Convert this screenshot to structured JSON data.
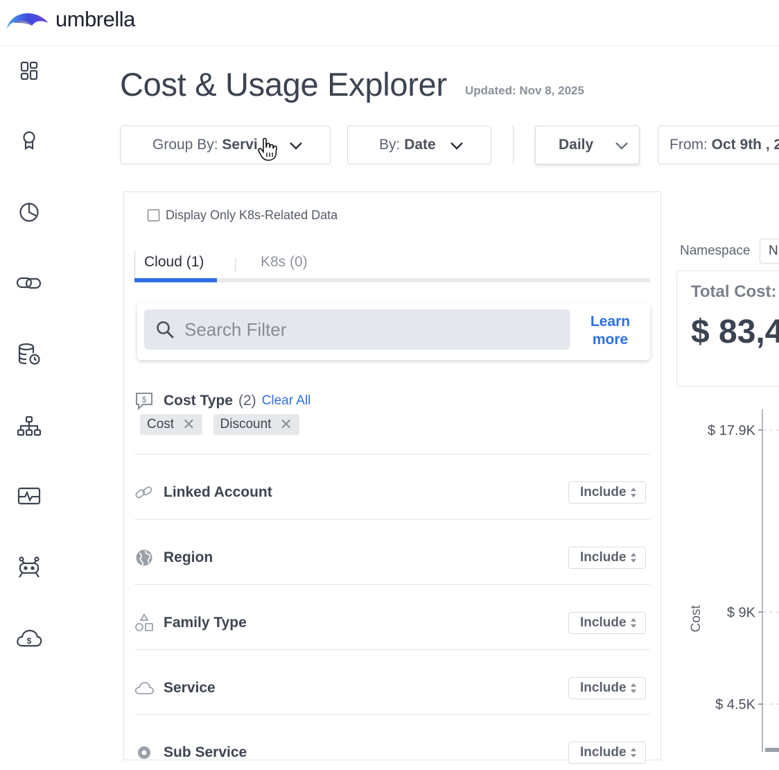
{
  "app": {
    "brand": "umbrella"
  },
  "leftnav": {
    "items": [
      {
        "name": "dashboard-icon"
      },
      {
        "name": "award-icon"
      },
      {
        "name": "pie-chart-icon"
      },
      {
        "name": "link-icon"
      },
      {
        "name": "database-clock-icon"
      },
      {
        "name": "hierarchy-icon"
      },
      {
        "name": "monitor-pulse-icon"
      },
      {
        "name": "bot-icon"
      },
      {
        "name": "cloud-dollar-icon"
      }
    ]
  },
  "header": {
    "title": "Cost & Usage Explorer",
    "updated": "Updated: Nov 8, 2025"
  },
  "controls": {
    "group_by_prefix": "Group By: ",
    "group_by_value": "Servi",
    "by_prefix": "By: ",
    "by_value": "Date",
    "granularity": "Daily",
    "from_prefix": "From: ",
    "from_value": "Oct 9th , 2"
  },
  "filters": {
    "k8s_only_label": "Display Only K8s-Related Data",
    "tabs": {
      "cloud": "Cloud (1)",
      "k8s": "K8s (0)"
    },
    "search_placeholder": "Search Filter",
    "learn_more": "Learn more",
    "cost_type": {
      "label": "Cost Type",
      "count": "(2)",
      "clear": "Clear All",
      "chips": [
        "Cost",
        "Discount"
      ]
    },
    "rows": [
      {
        "label": "Linked Account",
        "mode": "Include",
        "icon": "link-icon"
      },
      {
        "label": "Region",
        "mode": "Include",
        "icon": "globe-icon"
      },
      {
        "label": "Family Type",
        "mode": "Include",
        "icon": "shapes-icon"
      },
      {
        "label": "Service",
        "mode": "Include",
        "icon": "cloud-icon"
      },
      {
        "label": "Sub Service",
        "mode": "Include",
        "icon": "gear-icon"
      }
    ]
  },
  "summary": {
    "namespace_label": "Namespace",
    "namespace_value": "N",
    "total_label": "Total Cost:",
    "total_value": "$ 83,4"
  },
  "chart_data": {
    "type": "bar",
    "ylabel": "Cost",
    "y_ticks": [
      "$ 17.9K",
      "$ 9K",
      "$ 4.5K"
    ],
    "y_tick_values": [
      17900,
      9000,
      4500
    ]
  }
}
